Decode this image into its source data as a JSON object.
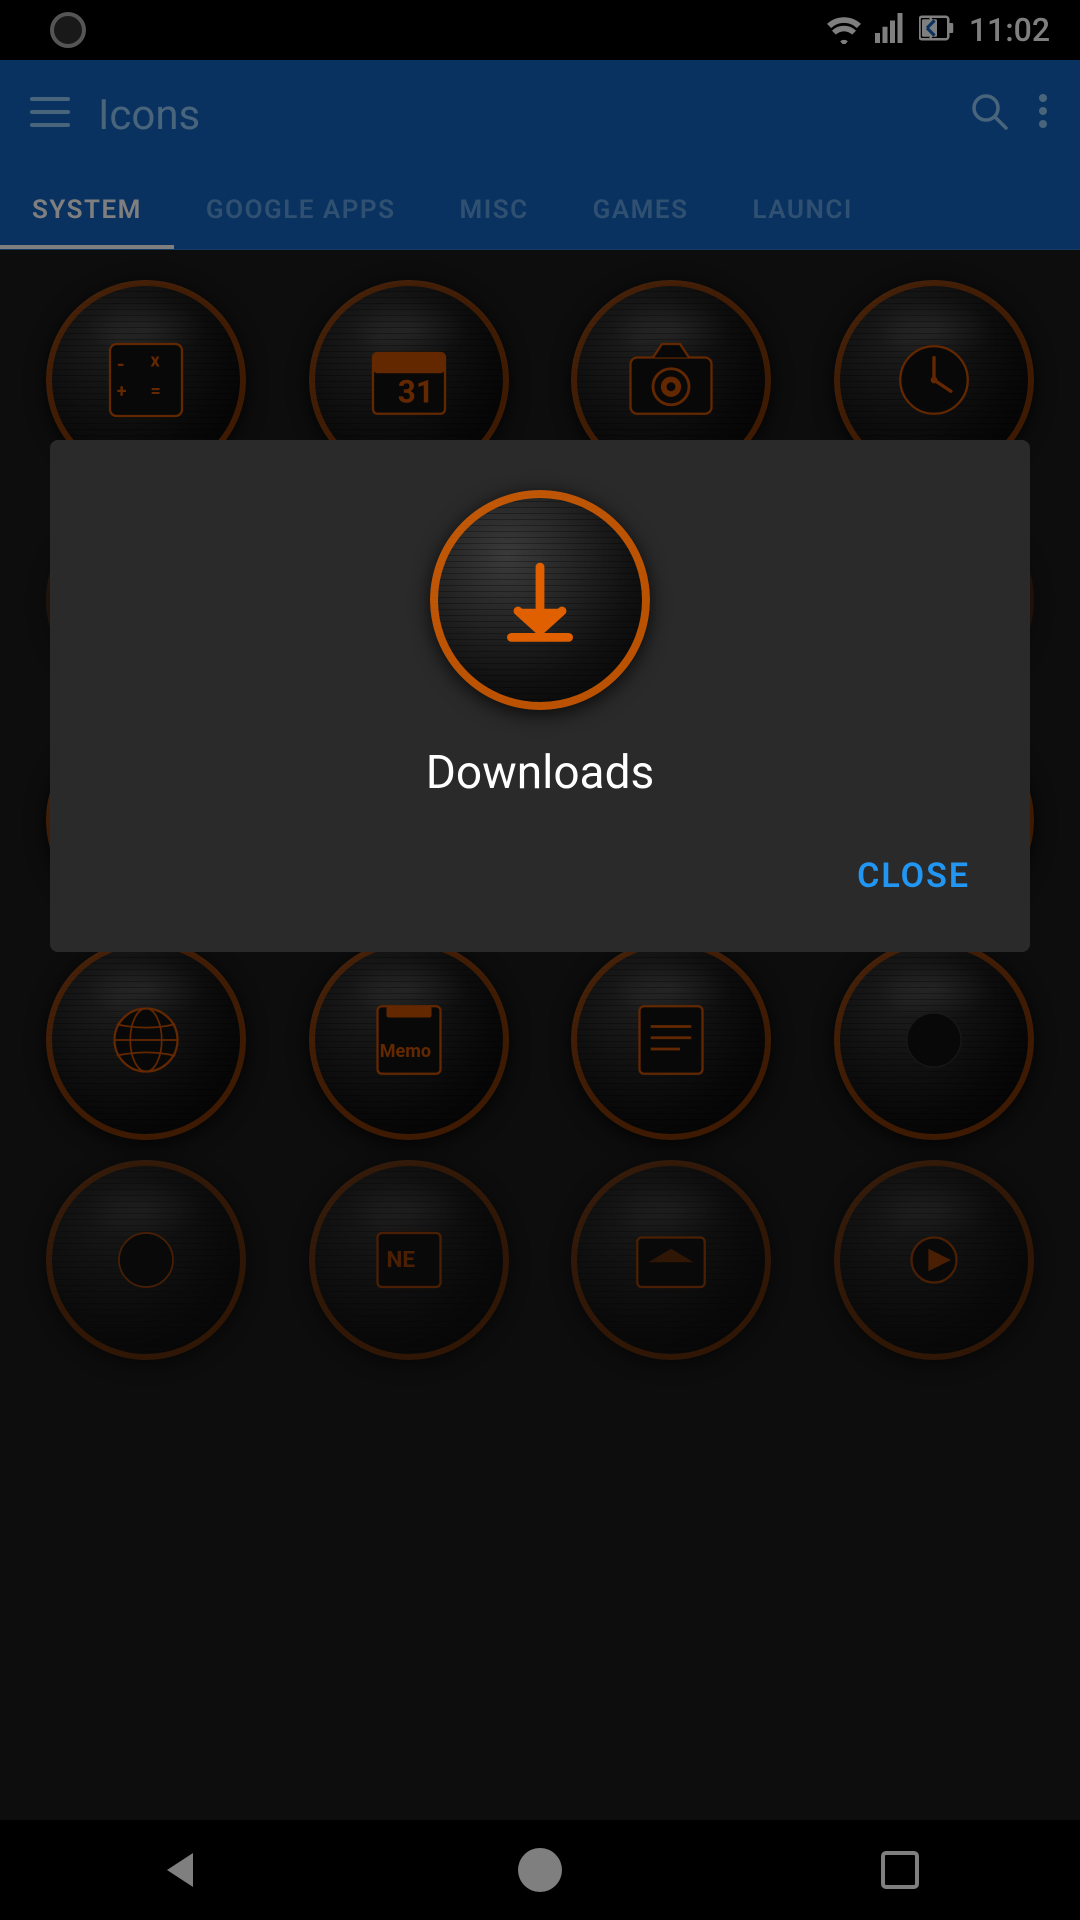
{
  "status_bar": {
    "time": "11:02"
  },
  "app_bar": {
    "title": "Icons",
    "menu_label": "☰",
    "search_label": "🔍",
    "more_label": "⋮"
  },
  "tabs": [
    {
      "id": "system",
      "label": "SYSTEM",
      "active": true
    },
    {
      "id": "google-apps",
      "label": "GOOGLE APPS",
      "active": false
    },
    {
      "id": "misc",
      "label": "MISC",
      "active": false
    },
    {
      "id": "games",
      "label": "GAMES",
      "active": false
    },
    {
      "id": "launcher",
      "label": "LAUNCI",
      "active": false
    }
  ],
  "dialog": {
    "icon_name": "downloads-dialog-icon",
    "title": "Downloads",
    "close_label": "CLOSE"
  },
  "bottom_nav": {
    "back_label": "back",
    "home_label": "home",
    "recents_label": "recents"
  }
}
